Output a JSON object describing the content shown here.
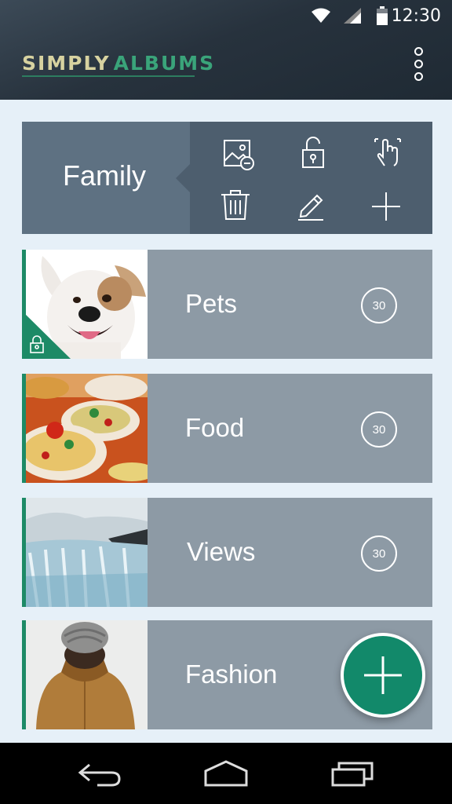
{
  "status": {
    "time": "12:30"
  },
  "header": {
    "logo_part1": "SIMPLY",
    "logo_part2": "ALBUMS"
  },
  "family": {
    "label": "Family"
  },
  "albums": [
    {
      "title": "Pets",
      "count": "30",
      "locked": true
    },
    {
      "title": "Food",
      "count": "30"
    },
    {
      "title": "Views",
      "count": "30"
    },
    {
      "title": "Fashion"
    }
  ],
  "colors": {
    "accent": "#12896a",
    "card": "#8d9aa5",
    "family_bg": "#5e7182",
    "background": "#e6f0f8"
  },
  "icons": [
    "wifi-icon",
    "signal-icon",
    "battery-icon",
    "more-vert-icon",
    "remove-image-icon",
    "unlock-icon",
    "touch-select-icon",
    "delete-icon",
    "edit-icon",
    "add-icon",
    "lock-icon",
    "fab-add-icon",
    "back-icon",
    "home-icon",
    "recents-icon"
  ]
}
